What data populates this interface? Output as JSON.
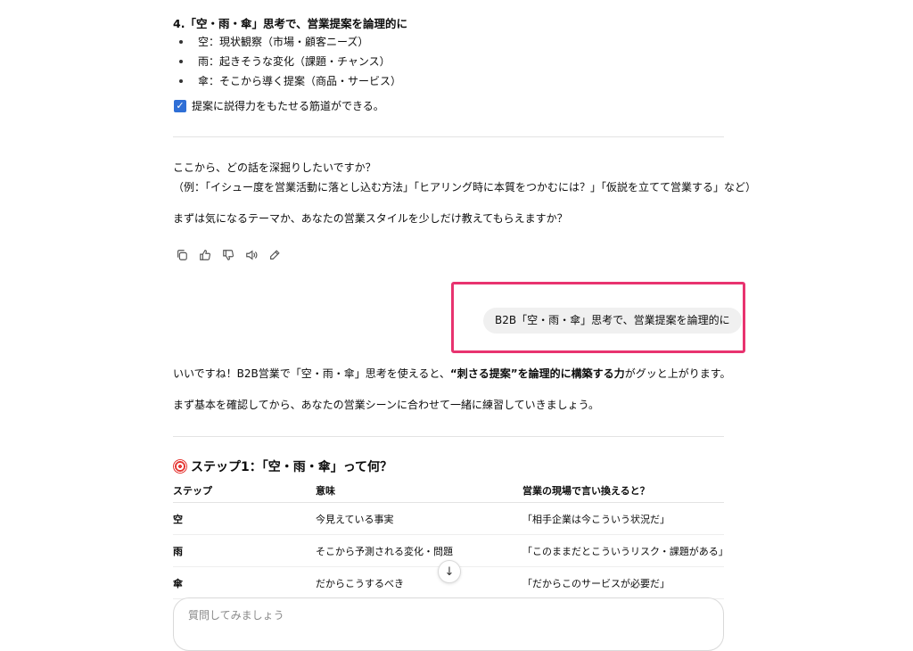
{
  "prev_answer": {
    "heading": "4.「空・雨・傘」思考で、営業提案を論理的に",
    "bullets": [
      "空：現状観察（市場・顧客ニーズ）",
      "雨：起きそうな変化（課題・チャンス）",
      "傘：そこから導く提案（商品・サービス）"
    ],
    "check_text": "提案に説得力をもたせる筋道ができる。",
    "question": "ここから、どの話を深掘りしたいですか？",
    "example": "（例：「イシュー度を営業活動に落とし込む方法」「ヒアリング時に本質をつかむには？」「仮説を立てて営業する」など）",
    "closing": "まずは気になるテーマか、あなたの営業スタイルを少しだけ教えてもらえますか？"
  },
  "actions": [
    {
      "icon": "copy-icon"
    },
    {
      "icon": "thumbs-up-icon"
    },
    {
      "icon": "thumbs-down-icon"
    },
    {
      "icon": "speaker-icon"
    },
    {
      "icon": "edit-icon"
    }
  ],
  "user_message": "B2B「空・雨・傘」思考で、営業提案を論理的に",
  "highlight_color": "#e8336f",
  "answer": {
    "p1_a": "いいですね！B2B営業で「空・雨・傘」思考を使えると、",
    "p1_b": "“刺さる提案”を論理的に構築する力",
    "p1_c": "がグッと上がります。",
    "p2": "まず基本を確認してから、あなたの営業シーンに合わせて一緒に練習していきましょう。",
    "step_title": "ステップ1：「空・雨・傘」って何？",
    "table": {
      "headers": [
        "ステップ",
        "意味",
        "営業の現場で言い換えると？"
      ],
      "rows": [
        [
          "空",
          "今見えている事実",
          "「相手企業は今こういう状況だ」"
        ],
        [
          "雨",
          "そこから予測される変化・問題",
          "「このままだとこういうリスク・課題がある」"
        ],
        [
          "傘",
          "だからこうするべき",
          "「だからこのサービスが必要だ」"
        ]
      ]
    }
  },
  "composer": {
    "placeholder": "質問してみましょう"
  }
}
